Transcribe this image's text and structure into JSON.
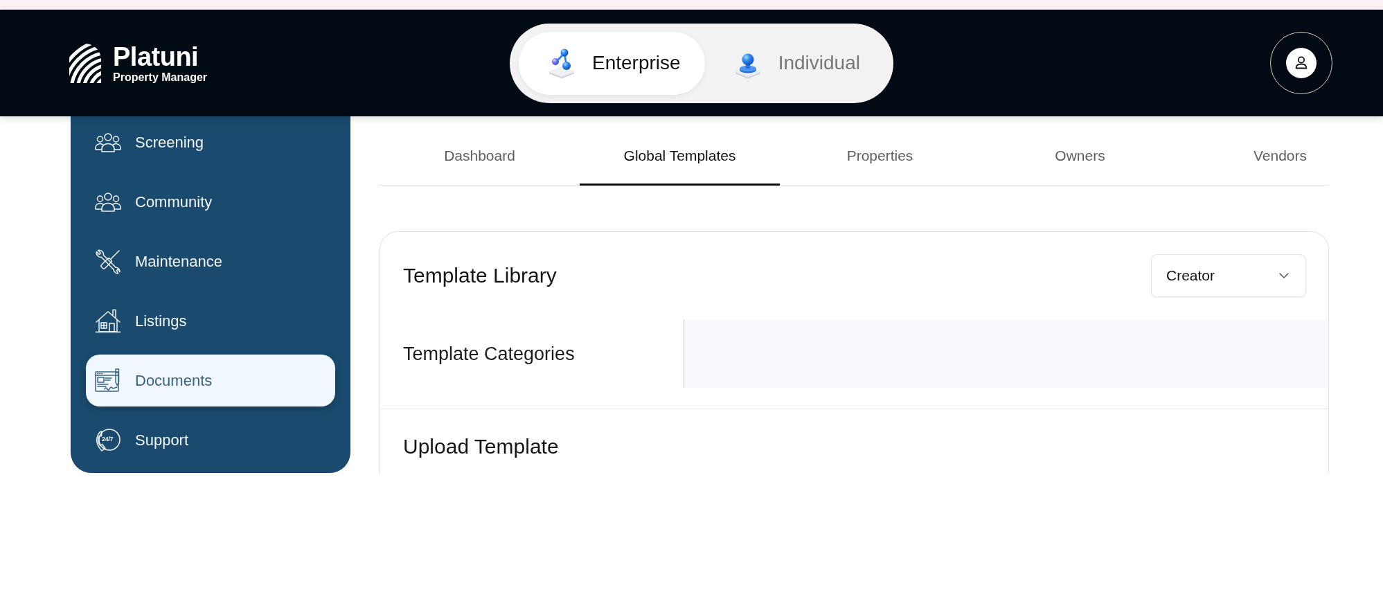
{
  "header": {
    "logo": {
      "name": "Platuni",
      "tagline": "Property Manager"
    },
    "mode_toggle": [
      {
        "label": "Enterprise",
        "selected": true
      },
      {
        "label": "Individual",
        "selected": false
      }
    ]
  },
  "sidebar": {
    "items": [
      {
        "label": "Screening",
        "selected": false
      },
      {
        "label": "Community",
        "selected": false
      },
      {
        "label": "Maintenance",
        "selected": false
      },
      {
        "label": "Listings",
        "selected": false
      },
      {
        "label": "Documents",
        "selected": true
      },
      {
        "label": "Support",
        "selected": false,
        "icon_text": "24/7"
      }
    ]
  },
  "tabs": [
    {
      "label": "Dashboard",
      "selected": false
    },
    {
      "label": "Global Templates",
      "selected": true
    },
    {
      "label": "Properties",
      "selected": false
    },
    {
      "label": "Owners",
      "selected": false
    },
    {
      "label": "Vendors",
      "selected": false
    }
  ],
  "template_library": {
    "title": "Template Library",
    "creator_select": {
      "value": "Creator"
    },
    "categories_label": "Template Categories",
    "upload_title": "Upload Template"
  }
}
